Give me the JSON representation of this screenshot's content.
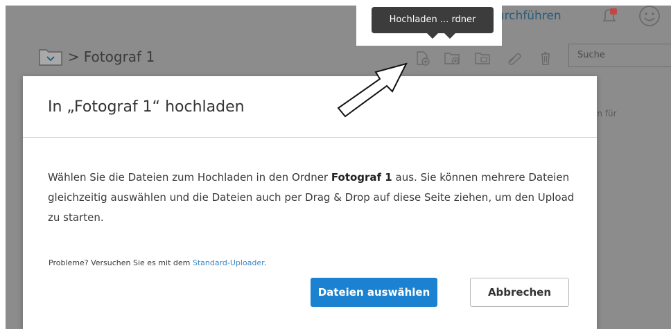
{
  "topbar": {
    "action_link": "durchführen"
  },
  "tooltip": {
    "text": "Hochladen ... rdner"
  },
  "breadcrumb": {
    "separator": ">",
    "current": "Fotograf 1"
  },
  "search": {
    "placeholder": "Suche"
  },
  "side_text": "en für",
  "dialog": {
    "title": "In „Fotograf 1“ hochladen",
    "body_part1": "Wählen Sie die Dateien zum Hochladen in den Ordner ",
    "body_bold": "Fotograf 1",
    "body_part2": " aus. Sie können mehrere Dateien gleichzeitig auswählen und die Dateien auch per Drag & Drop auf diese Seite ziehen, um den Upload zu starten.",
    "hint_prefix": "Probleme? Versuchen Sie es mit dem ",
    "hint_link": "Standard-Uploader",
    "hint_suffix": ".",
    "primary_button": "Dateien auswählen",
    "secondary_button": "Abbrechen"
  },
  "colors": {
    "primary": "#1a82d0",
    "overlay": "#8c8c8c",
    "link": "#3a86c7"
  },
  "icons": [
    "folder-icon",
    "notification-icon",
    "smiley-icon",
    "upload-file-icon",
    "upload-folder-icon",
    "new-folder-icon",
    "attachment-icon",
    "trash-icon",
    "arrow-annotation"
  ]
}
